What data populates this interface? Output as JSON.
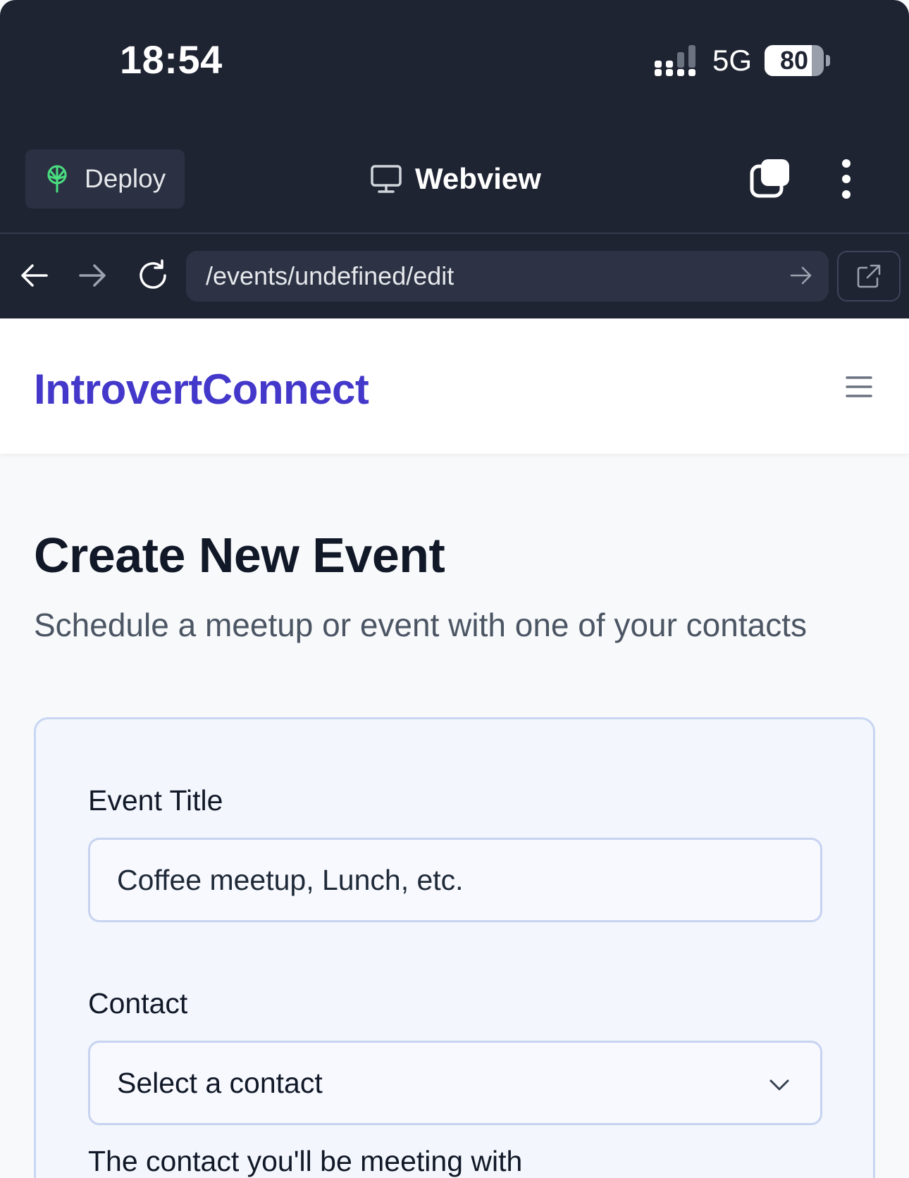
{
  "status_bar": {
    "time": "18:54",
    "network": "5G",
    "battery_percent": "80",
    "battery_level": 0.8
  },
  "toolbar": {
    "deploy_label": "Deploy",
    "view_label": "Webview"
  },
  "browser": {
    "url": "/events/undefined/edit"
  },
  "app": {
    "brand": "IntrovertConnect"
  },
  "page": {
    "title": "Create New Event",
    "subtitle": "Schedule a meetup or event with one of your contacts"
  },
  "form": {
    "event_title_label": "Event Title",
    "event_title_placeholder": "Coffee meetup, Lunch, etc.",
    "contact_label": "Contact",
    "contact_selected": "Select a contact",
    "contact_help": "The contact you'll be meeting with"
  },
  "colors": {
    "chrome_bg": "#1f2433",
    "brand": "#4338ca",
    "deploy_icon": "#4ade80"
  },
  "icons": {
    "deploy": "antenna-icon",
    "view": "monitor-icon",
    "tabs": "tabs-icon",
    "more": "more-vertical-icon",
    "back": "arrow-left-icon",
    "forward": "arrow-right-icon",
    "reload": "reload-icon",
    "go": "arrow-right-icon",
    "external": "external-link-icon",
    "menu": "hamburger-menu-icon",
    "select": "chevron-down-icon"
  }
}
